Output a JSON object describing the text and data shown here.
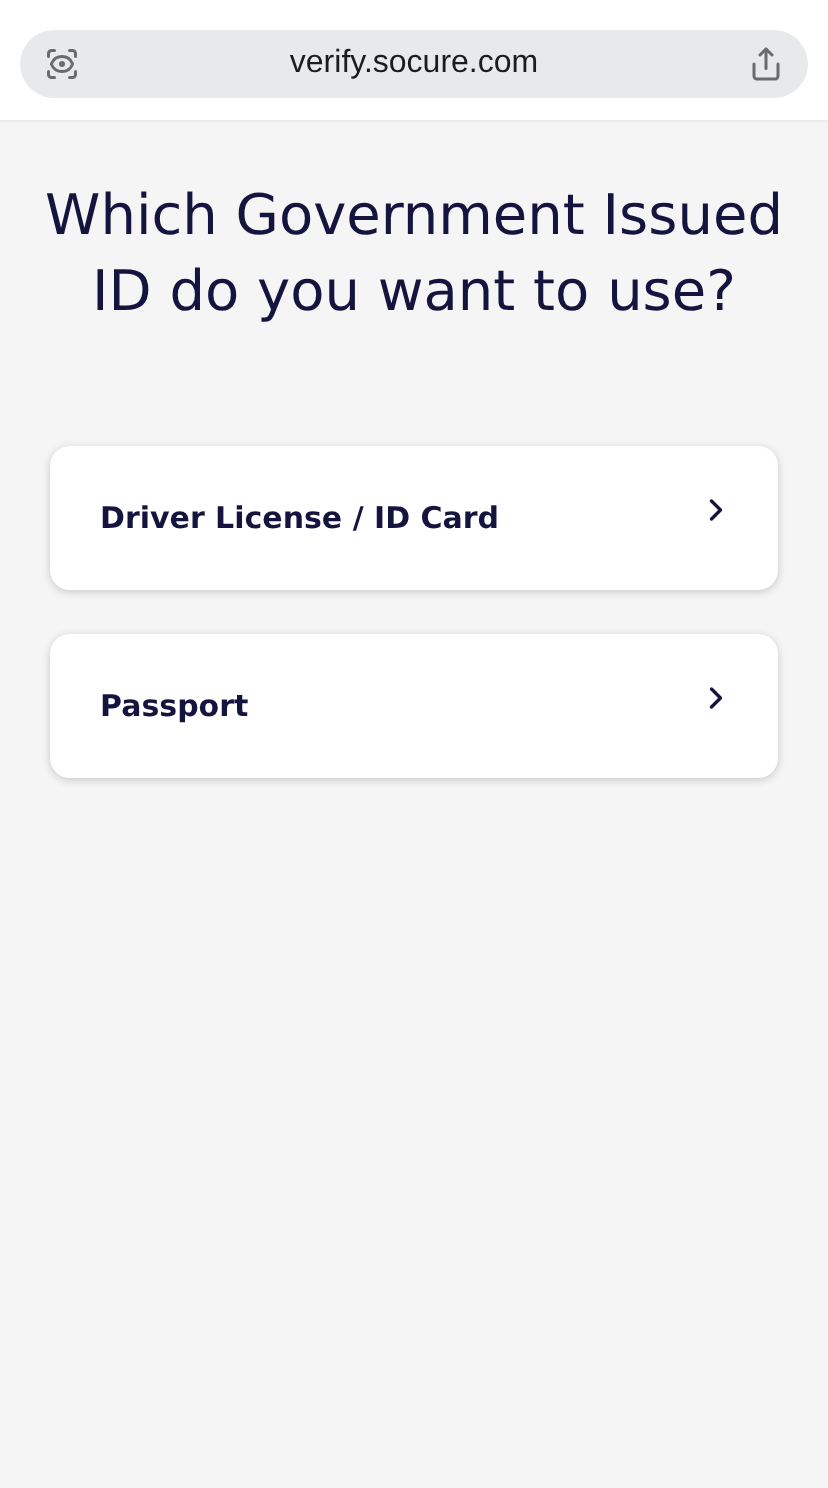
{
  "browser": {
    "url": "verify.socure.com"
  },
  "heading": "Which Government Issued ID do you want to use?",
  "options": [
    {
      "label": "Driver License / ID Card"
    },
    {
      "label": "Passport"
    }
  ]
}
